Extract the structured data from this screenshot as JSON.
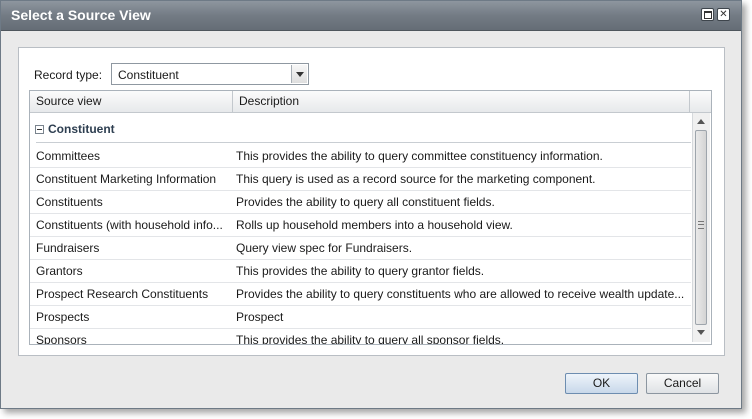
{
  "window": {
    "title": "Select a Source View"
  },
  "record_type": {
    "label": "Record type:",
    "value": "Constituent"
  },
  "grid": {
    "columns": [
      "Source view",
      "Description"
    ],
    "group_label": "Constituent",
    "rows": [
      {
        "source": "Committees",
        "description": "This provides the ability to query committee constituency information."
      },
      {
        "source": "Constituent Marketing Information",
        "description": "This query is used as a record source for the marketing component."
      },
      {
        "source": "Constituents",
        "description": "Provides the ability to query all constituent fields."
      },
      {
        "source": "Constituents (with household info...",
        "description": "Rolls up household members into a household view."
      },
      {
        "source": "Fundraisers",
        "description": "Query view spec for Fundraisers."
      },
      {
        "source": "Grantors",
        "description": "This provides the ability to query grantor fields."
      },
      {
        "source": "Prospect Research Constituents",
        "description": "Provides the ability to query constituents who are allowed to receive wealth update..."
      },
      {
        "source": "Prospects",
        "description": "Prospect"
      },
      {
        "source": "Sponsors",
        "description": "This provides the ability to query all sponsor fields."
      }
    ]
  },
  "buttons": {
    "ok": "OK",
    "cancel": "Cancel"
  },
  "icons": {
    "maximize": "maximize-icon",
    "close": "close-icon",
    "collapse": "collapse-icon",
    "dropdown": "chevron-down-icon"
  }
}
